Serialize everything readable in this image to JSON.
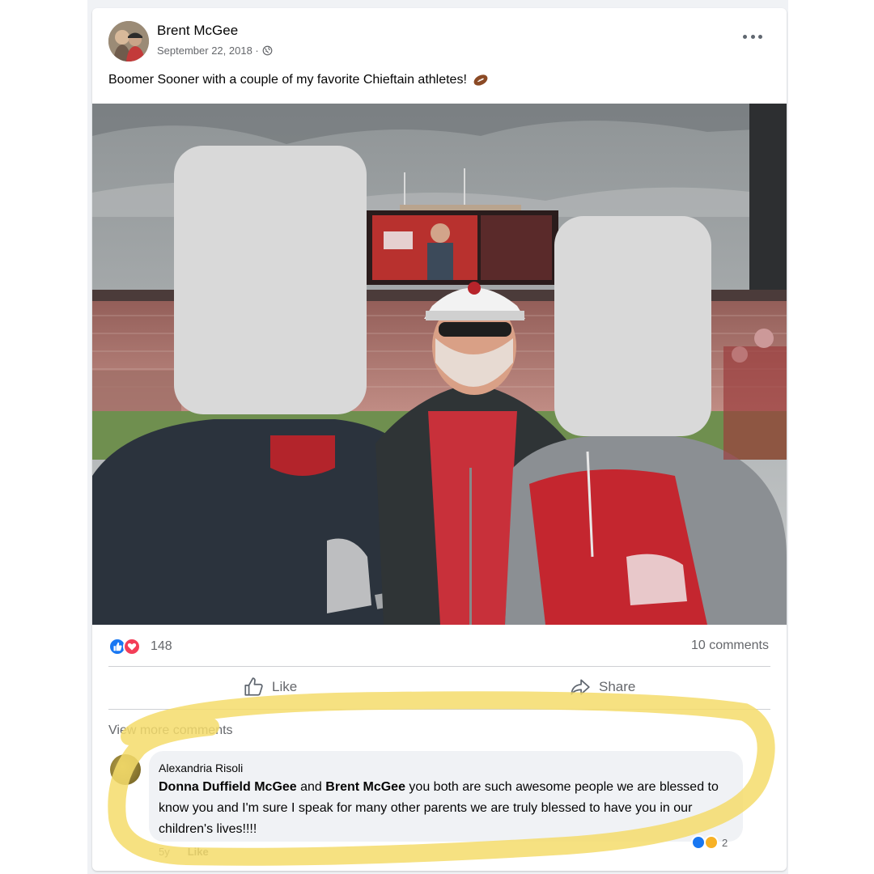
{
  "post": {
    "author": "Brent McGee",
    "date": "September 22, 2018 ·",
    "privacy_icon": "globe-icon",
    "text": "Boomer Sooner with a couple of my favorite Chieftain athletes!",
    "emoji": "football-icon"
  },
  "stats": {
    "reaction_count": "148",
    "comments_label": "10 comments"
  },
  "actions": {
    "like_label": "Like",
    "share_label": "Share"
  },
  "comments": {
    "view_more_label": "View more comments",
    "items": [
      {
        "author": "Alexandria Risoli",
        "tag1": "Donna Duffield McGee",
        "mid": " and ",
        "tag2": "Brent McGee",
        "rest": " you both are such awesome people we are blessed to know you and I'm sure I speak for many other parents we are truly blessed to have you in our children's lives!!!!",
        "age": "5y",
        "like_label": "Like",
        "reaction_count": "2"
      }
    ]
  },
  "colors": {
    "accent": "#1877f2",
    "love": "#f33e58",
    "highlight": "#f5dc6b"
  }
}
